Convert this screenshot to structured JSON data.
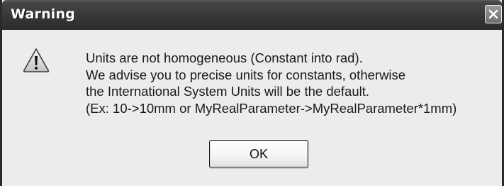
{
  "window": {
    "title": "Warning",
    "close_icon": "close-icon"
  },
  "message": {
    "icon": "warning-icon",
    "lines": [
      "Units are not homogeneous (Constant into rad).",
      "We advise you to precise units for constants, otherwise",
      "the International System Units will be the default.",
      "(Ex: 10->10mm or MyRealParameter->MyRealParameter*1mm)"
    ]
  },
  "buttons": {
    "ok_label": "OK"
  },
  "colors": {
    "titlebar": "#383838",
    "title_text": "#ffffff",
    "dialog_background": "#ececec",
    "border": "#2a2a2a"
  }
}
